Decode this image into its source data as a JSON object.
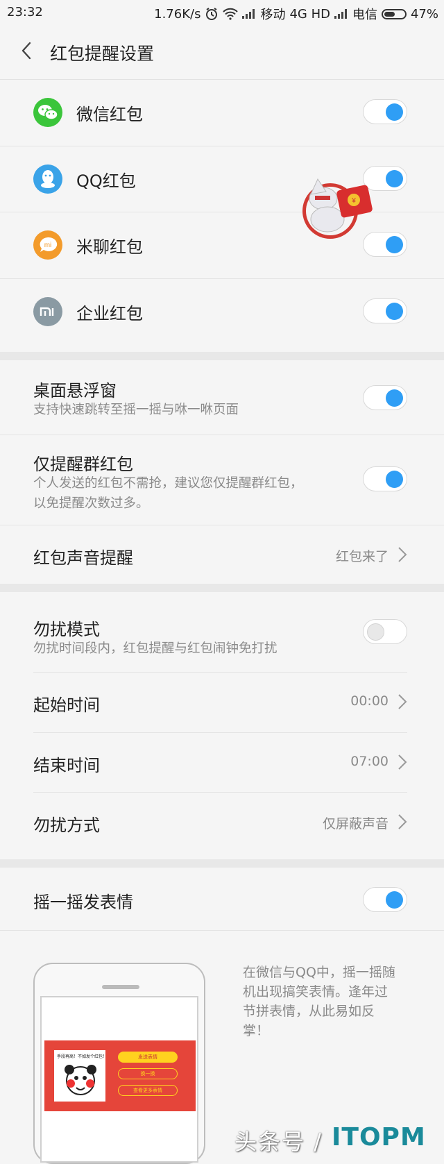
{
  "status_bar": {
    "time": "23:32",
    "speed": "1.76K/s",
    "carrier1": "移动",
    "net": "4G HD",
    "carrier2": "电信",
    "battery": "47%"
  },
  "header": {
    "title": "红包提醒设置"
  },
  "apps": [
    {
      "label": "微信红包",
      "icon": "wechat-icon",
      "color": "#3bc53b",
      "enabled": true
    },
    {
      "label": "QQ红包",
      "icon": "qq-icon",
      "color": "#3aa3e8",
      "enabled": true
    },
    {
      "label": "米聊红包",
      "icon": "miliao-icon",
      "color": "#f39b2b",
      "enabled": true
    },
    {
      "label": "企业红包",
      "icon": "mi-icon",
      "color": "#8a9aa3",
      "enabled": true
    }
  ],
  "floating": {
    "label": "桌面悬浮窗",
    "desc": "支持快速跳转至摇一摇与咻一咻页面",
    "enabled": true
  },
  "group_only": {
    "label": "仅提醒群红包",
    "desc": "个人发送的红包不需抢，建议您仅提醒群红包，以免提醒次数过多。",
    "enabled": true
  },
  "sound": {
    "label": "红包声音提醒",
    "value": "红包来了"
  },
  "dnd": {
    "label": "勿扰模式",
    "desc": "勿扰时间段内，红包提醒与红包闹钟免打扰",
    "enabled": false
  },
  "start_time": {
    "label": "起始时间",
    "value": "00:00"
  },
  "end_time": {
    "label": "结束时间",
    "value": "07:00"
  },
  "dnd_mode": {
    "label": "勿扰方式",
    "value": "仅屏蔽声音"
  },
  "shake": {
    "label": "摇一摇发表情",
    "enabled": true
  },
  "promo": {
    "text": "在微信与QQ中，摇一摇随机出现搞笑表情。逢年过节拼表情，从此易如反掌！",
    "card_caption": "手段再高！不如发个红包！",
    "btn_send": "发送表情",
    "btn_change": "换一换",
    "btn_more": "查看更多表情"
  },
  "watermark": {
    "text1": "头条号 /",
    "text2": "ITOPM"
  },
  "colors": {
    "accent": "#2f9ef5",
    "red": "#e5453a"
  }
}
